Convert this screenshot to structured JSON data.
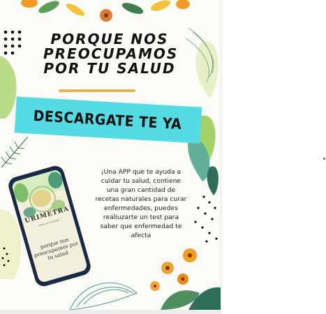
{
  "title_lines": [
    "PORQUE NOS",
    "PREOCUPAMOS",
    "POR TU SALUD"
  ],
  "banner": "DESCARGATE TE YA",
  "description": "¡Una APP que te ayuda a cuidar tu salud, contiene una gran cantidad de recetas naturales para curar enfermedades, puedes realiuzarte un test para saber que enfermedad te afecta",
  "phone": {
    "app_name": "URIMETRA",
    "tagline": "Cuidar por lo natural",
    "screen_text": "porque nos preocupamos por tu salud"
  },
  "colors": {
    "banner": "#55dbe3",
    "underline": "#e3b451",
    "phone_frame": "#1a2a45",
    "leaf_green": "#9ed36a",
    "flower_orange": "#f39b2a"
  }
}
